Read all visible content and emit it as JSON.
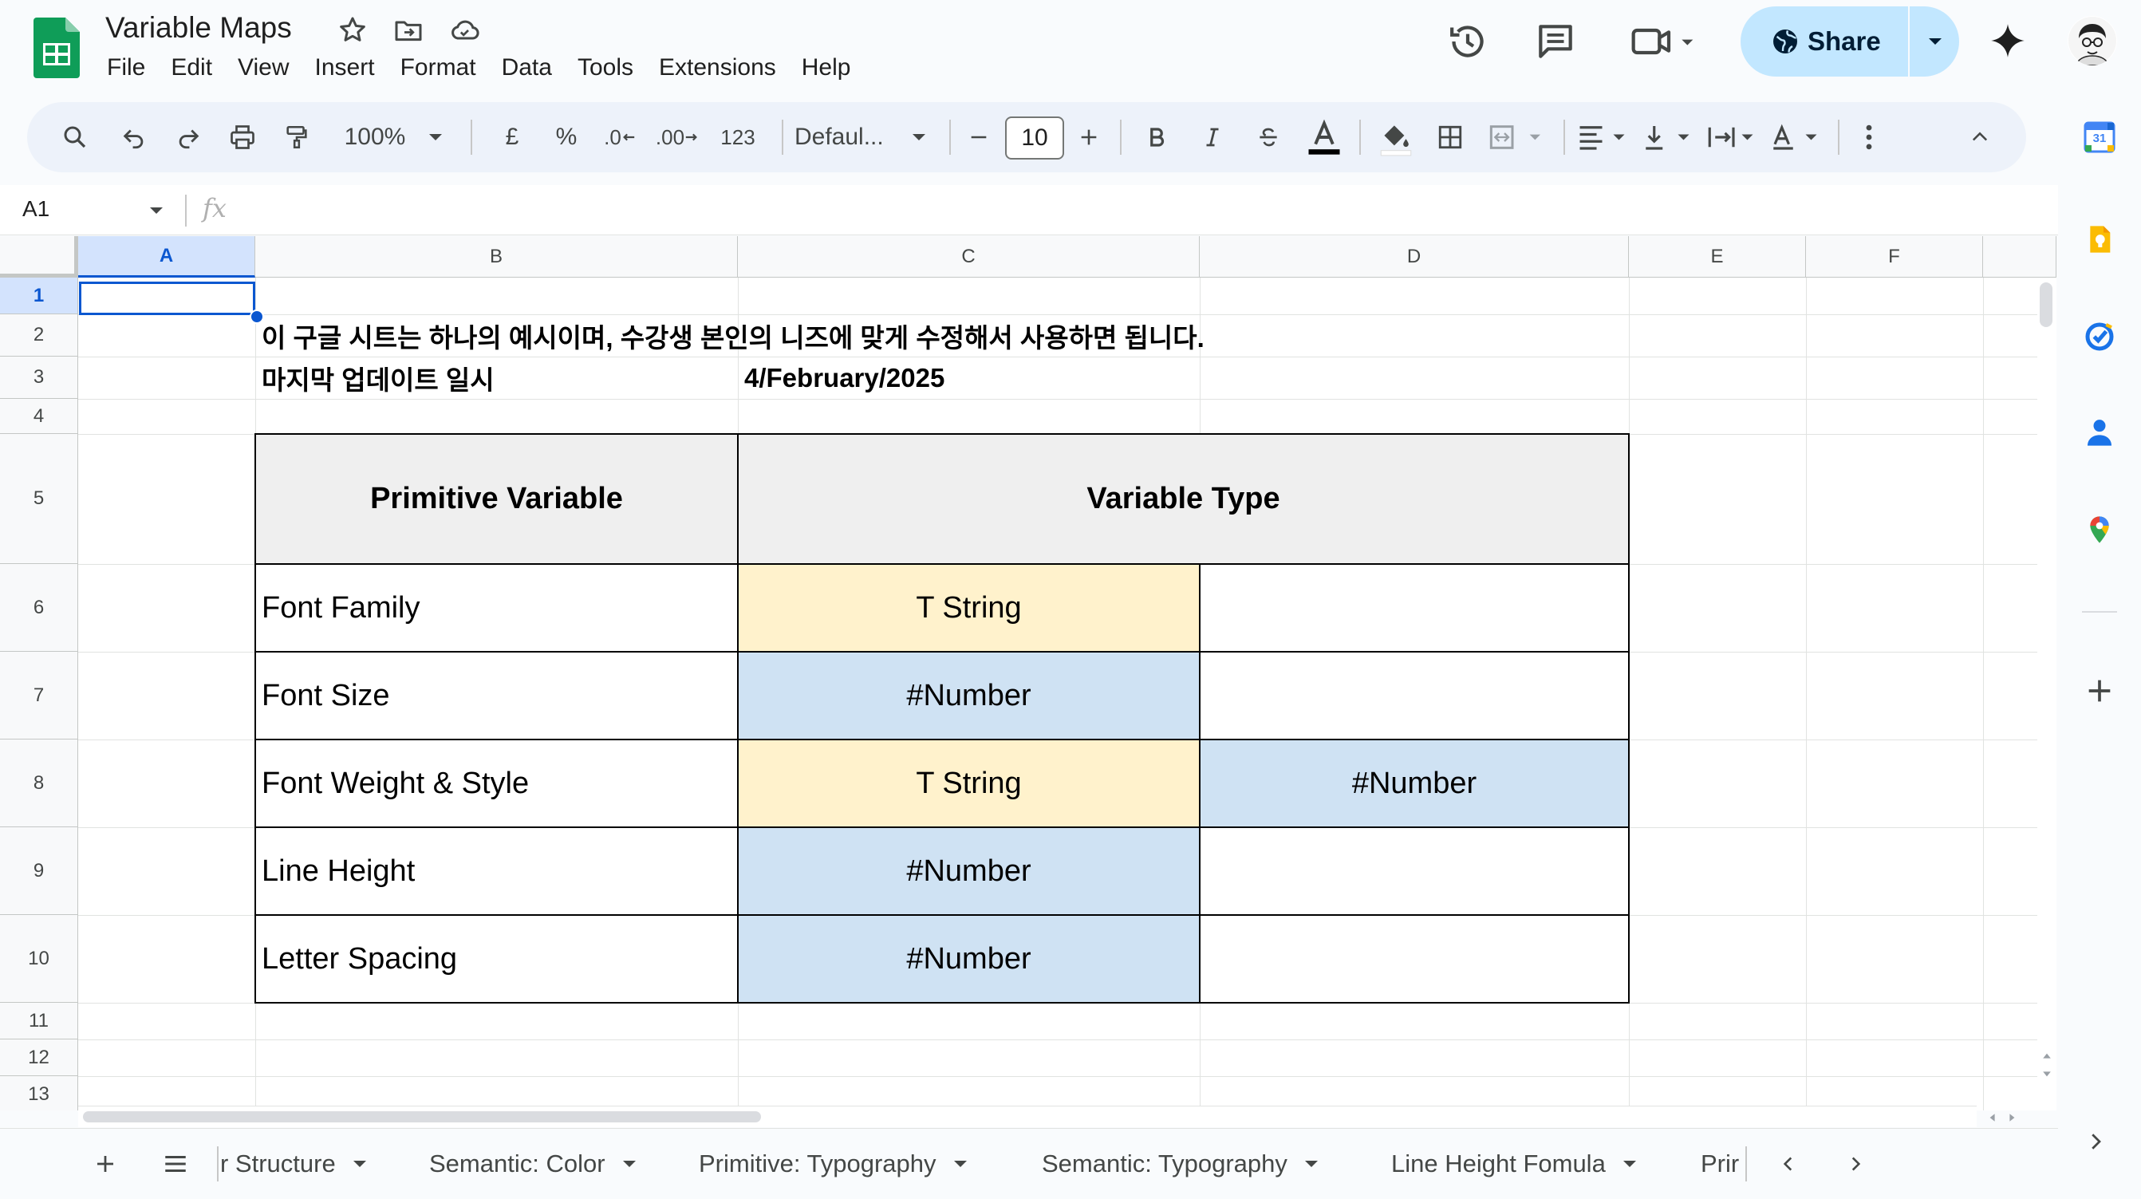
{
  "app": {
    "title": "Variable Maps",
    "menu": [
      "File",
      "Edit",
      "View",
      "Insert",
      "Format",
      "Data",
      "Tools",
      "Extensions",
      "Help"
    ],
    "share_label": "Share",
    "colors": {
      "brand": "#0f9d58",
      "share_bg": "#c2e7ff",
      "selection": "#0b57d0"
    }
  },
  "toolbar": {
    "zoom": "100%",
    "currency": "£",
    "percent": "%",
    "decrease_decimal": ".0",
    "increase_decimal": ".00",
    "number_format": "123",
    "font": "Defaul...",
    "font_size": "10"
  },
  "formula_bar": {
    "cell_ref": "A1",
    "fx": "fx",
    "value": ""
  },
  "grid": {
    "columns": [
      "A",
      "B",
      "C",
      "D",
      "E",
      "F"
    ],
    "rows": [
      "1",
      "2",
      "3",
      "4",
      "5",
      "6",
      "7",
      "8",
      "9",
      "10",
      "11",
      "12",
      "13"
    ],
    "selected_cell": "A1",
    "notice": "이 구글 시트는 하나의 예시이며, 수강생 본인의 니즈에 맞게 수정해서 사용하면 됩니다.",
    "last_updated_label": "마지막 업데이트 일시",
    "last_updated_value": "4/February/2025",
    "table": {
      "headers": [
        "Primitive Variable",
        "Variable Type"
      ],
      "rows": [
        {
          "variable": "Font Family",
          "type1": "T String",
          "type1_color": "yellow",
          "type2": "",
          "type2_color": "white"
        },
        {
          "variable": "Font Size",
          "type1": "#Number",
          "type1_color": "blue",
          "type2": "",
          "type2_color": "white"
        },
        {
          "variable": "Font Weight & Style",
          "type1": "T String",
          "type1_color": "yellow",
          "type2": "#Number",
          "type2_color": "blue"
        },
        {
          "variable": "Line Height",
          "type1": "#Number",
          "type1_color": "blue",
          "type2": "",
          "type2_color": "white"
        },
        {
          "variable": "Letter Spacing",
          "type1": "#Number",
          "type1_color": "blue",
          "type2": "",
          "type2_color": "white"
        }
      ],
      "cell_colors": {
        "header": "#efefef",
        "yellow": "#fff2cc",
        "blue": "#cfe2f3"
      }
    }
  },
  "sheet_tabs": [
    "r Structure",
    "Semantic: Color",
    "Primitive: Typography",
    "Semantic: Typography",
    "Line Height Fomula",
    "Prir"
  ],
  "side_panel": {
    "calendar_day": "31",
    "icons": [
      "calendar-icon",
      "keep-icon",
      "tasks-icon",
      "contacts-icon",
      "maps-icon",
      "add-icon"
    ]
  }
}
